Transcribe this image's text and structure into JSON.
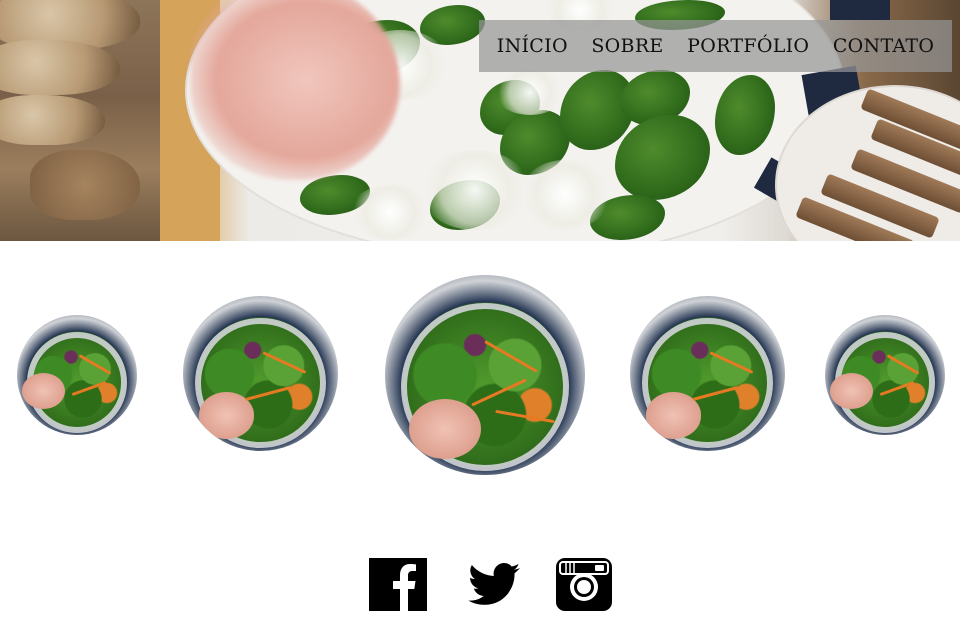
{
  "nav": {
    "items": [
      {
        "label": "INÍCIO"
      },
      {
        "label": "SOBRE"
      },
      {
        "label": "PORTFÓLIO"
      },
      {
        "label": "CONTATO"
      }
    ]
  },
  "hero": {
    "image": "food-table-banner"
  },
  "gallery": {
    "image": "salad-bowl-photo",
    "items": [
      {
        "name": "salad-bowl-photo"
      },
      {
        "name": "salad-bowl-photo"
      },
      {
        "name": "salad-bowl-photo"
      },
      {
        "name": "salad-bowl-photo"
      },
      {
        "name": "salad-bowl-photo"
      }
    ]
  },
  "social": {
    "icons": [
      "facebook-icon",
      "twitter-icon",
      "instagram-icon"
    ],
    "color": "#000000"
  },
  "colors": {
    "nav_background": "#969696",
    "nav_text": "#111111",
    "page_background": "#ffffff"
  }
}
